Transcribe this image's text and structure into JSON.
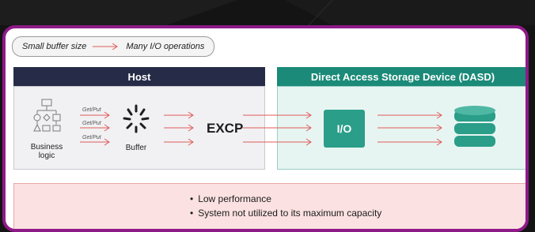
{
  "header": {
    "left_text": "Small buffer size",
    "right_text": "Many I/O operations"
  },
  "host": {
    "title": "Host",
    "business_logic_label_line1": "Business",
    "business_logic_label_line2": "logic",
    "getput_labels": [
      "Get/Put",
      "Get/Put",
      "Get/Put"
    ],
    "buffer_label": "Buffer",
    "excp_label": "EXCP"
  },
  "dasd": {
    "title": "Direct Access Storage Device (DASD)",
    "io_label": "I/O"
  },
  "problem": {
    "items": [
      "Low performance",
      "System not utilized to its maximum capacity"
    ]
  },
  "colors": {
    "frame": "#8e1a88",
    "host_header": "#262c47",
    "dasd_header": "#1b8a78",
    "arrow": "#e05a5a",
    "problem_bg": "#fbe1e1",
    "error": "#e0494b"
  },
  "icons": [
    "business-logic-icon",
    "buffer-spinner-icon",
    "database-icon",
    "error-icon"
  ]
}
